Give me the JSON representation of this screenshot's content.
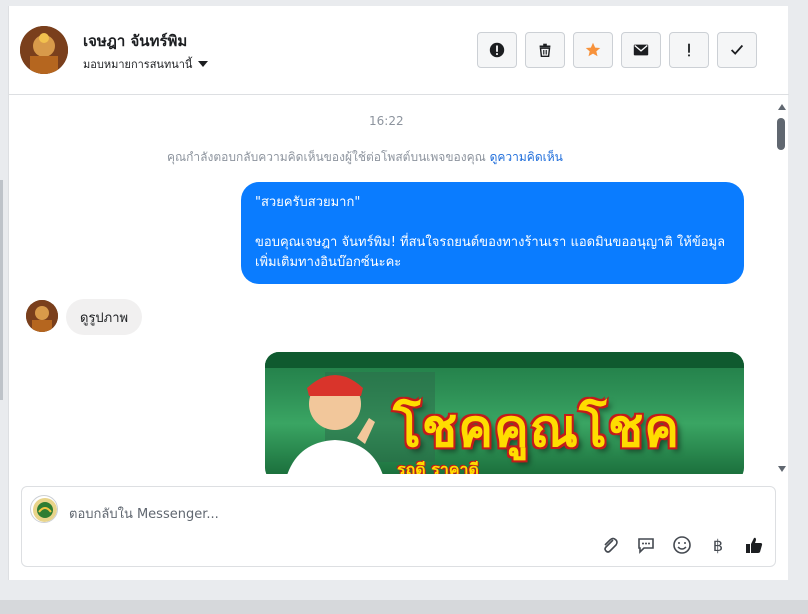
{
  "header": {
    "name": "เจษฎา จันทร์พิม",
    "assign_label": "มอบหมายการสนทนานี้",
    "actions": [
      {
        "icon": "exclamation-circle-icon"
      },
      {
        "icon": "trash-icon"
      },
      {
        "icon": "star-icon",
        "color": "#f7923b"
      },
      {
        "icon": "envelope-icon"
      },
      {
        "icon": "exclamation-icon"
      },
      {
        "icon": "checkmark-icon"
      }
    ]
  },
  "thread": {
    "timestamp": "16:22",
    "note_text": "คุณกำลังตอบกลับความคิดเห็นของผู้ใช้ต่อโพสต์บนเพจของคุณ",
    "note_link": "ดูความคิดเห็น",
    "outgoing": {
      "quote": "\"สวยครับสวยมาก\"",
      "body": "ขอบคุณเจษฎา จันทร์พิม! ที่สนใจรถยนต์ของทางร้านเรา แอดมินขออนุญาติ ให้ข้อมูลเพิ่มเติมทางอินบ๊อกซ์นะคะ"
    },
    "incoming": {
      "text": "ดูรูปภาพ"
    },
    "image": {
      "headline": "โชคคูณโชค",
      "subline": "รถดี ราคาดี"
    }
  },
  "composer": {
    "placeholder": "ตอบกลับใน Messenger...",
    "tools": [
      "paperclip-icon",
      "speech-bubble-icon",
      "emoji-icon",
      "baht-icon",
      "thumbs-up-icon"
    ],
    "baht_glyph": "฿"
  },
  "colors": {
    "outgoing_bubble": "#0a7cff",
    "incoming_bubble": "#f1f0f0",
    "link": "#216fdb",
    "accent_star": "#f7923b"
  }
}
